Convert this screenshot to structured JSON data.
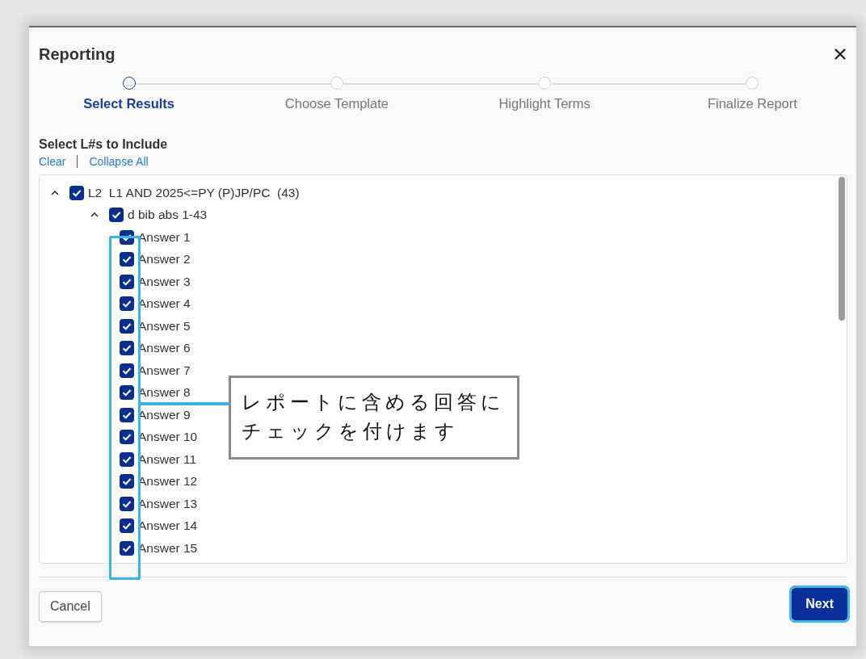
{
  "dialog": {
    "title": "Reporting"
  },
  "steps": [
    {
      "label": "Select Results",
      "selected": true
    },
    {
      "label": "Choose Template",
      "selected": false
    },
    {
      "label": "Highlight Terms",
      "selected": false
    },
    {
      "label": "Finalize Report",
      "selected": false
    }
  ],
  "section_title": "Select L#s to Include",
  "links": [
    "Clear",
    "Collapse All"
  ],
  "tree": [
    {
      "label": "L2  L1 AND 2025<=PY (P)JP/PC  (43)",
      "checked": true,
      "expanded": true,
      "children": [
        {
          "label": "d bib abs 1-43",
          "checked": true,
          "expanded": true,
          "children": [
            {
              "label": "Answer 1",
              "checked": true
            },
            {
              "label": "Answer 2",
              "checked": true
            },
            {
              "label": "Answer 3",
              "checked": true
            },
            {
              "label": "Answer 4",
              "checked": true
            },
            {
              "label": "Answer 5",
              "checked": true
            },
            {
              "label": "Answer 6",
              "checked": true
            },
            {
              "label": "Answer 7",
              "checked": true
            },
            {
              "label": "Answer 8",
              "checked": true
            },
            {
              "label": "Answer 9",
              "checked": true
            },
            {
              "label": "Answer 10",
              "checked": true
            },
            {
              "label": "Answer 11",
              "checked": true
            },
            {
              "label": "Answer 12",
              "checked": true
            },
            {
              "label": "Answer 13",
              "checked": true
            },
            {
              "label": "Answer 14",
              "checked": true
            },
            {
              "label": "Answer 15",
              "checked": true
            }
          ]
        }
      ]
    }
  ],
  "annotation": {
    "text": "レポートに含める回答にチェックを付けます"
  },
  "buttons": [
    {
      "label": "Cancel",
      "kind": "secondary",
      "focused": false
    },
    {
      "label": "Next",
      "kind": "primary",
      "focused": true
    }
  ]
}
